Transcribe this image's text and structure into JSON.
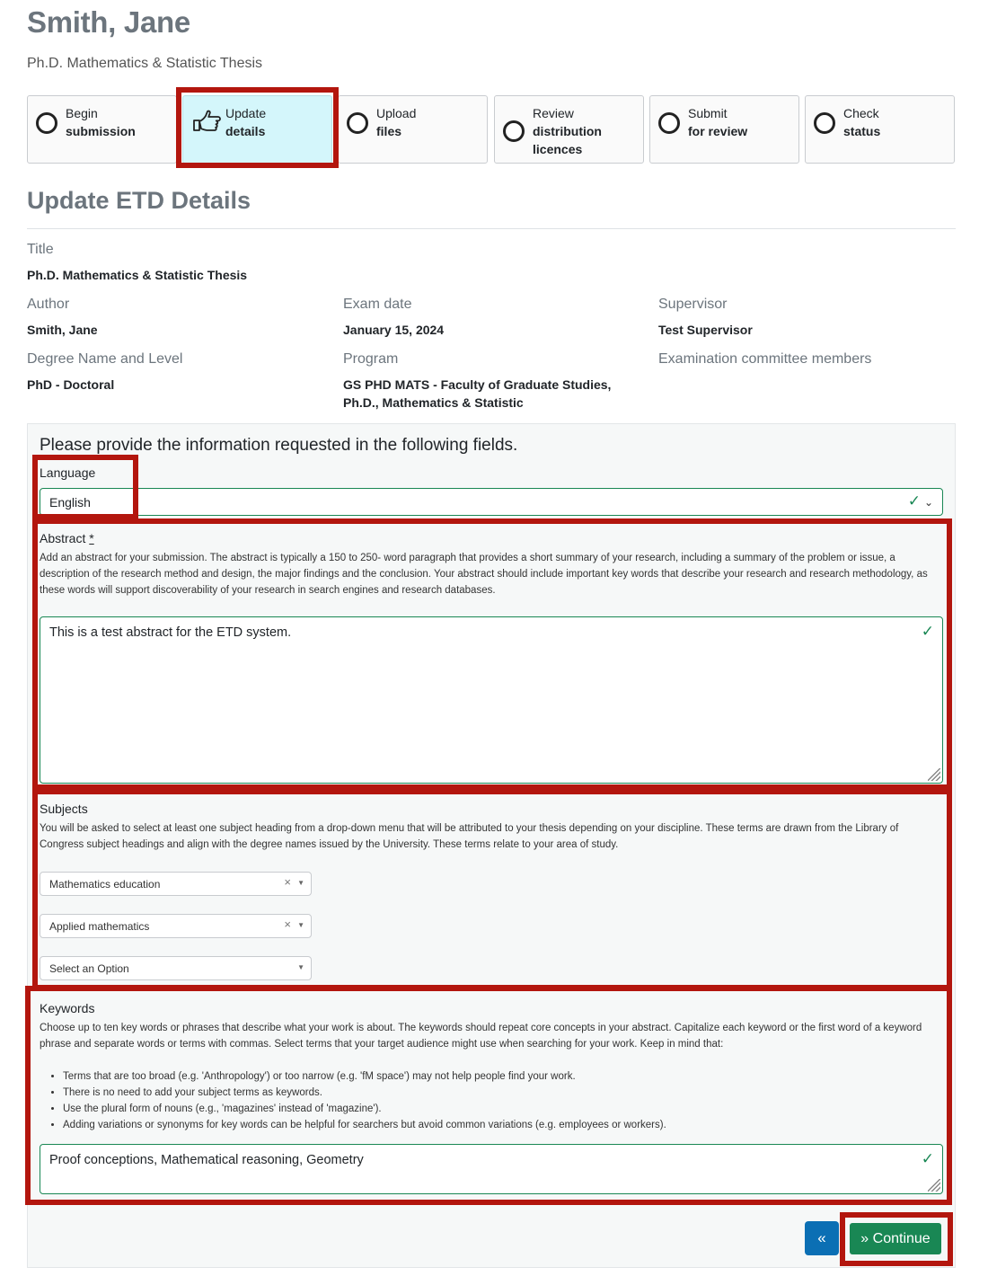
{
  "header": {
    "name": "Smith, Jane",
    "subtitle": "Ph.D. Mathematics & Statistic Thesis"
  },
  "steps": [
    {
      "line1": "Begin",
      "line2": "submission",
      "line3": ""
    },
    {
      "line1": "Update",
      "line2": "details",
      "line3": ""
    },
    {
      "line1": "Upload",
      "line2": "files",
      "line3": ""
    },
    {
      "line1": "Review",
      "line2": "distribution",
      "line3": "licences"
    },
    {
      "line1": "Submit",
      "line2": "for review",
      "line3": ""
    },
    {
      "line1": "Check",
      "line2": "status",
      "line3": ""
    }
  ],
  "section_title": "Update ETD Details",
  "details": {
    "title_label": "Title",
    "title_value": "Ph.D. Mathematics & Statistic Thesis",
    "author_label": "Author",
    "author_value": "Smith, Jane",
    "exam_label": "Exam date",
    "exam_value": "January 15, 2024",
    "supervisor_label": "Supervisor",
    "supervisor_value": "Test Supervisor",
    "degree_label": "Degree Name and Level",
    "degree_value": "PhD - Doctoral",
    "program_label": "Program",
    "program_line1": "GS PHD MATS - Faculty of Graduate Studies,",
    "program_line2": "Ph.D., Mathematics & Statistic",
    "committee_label": "Examination committee members"
  },
  "form": {
    "heading": "Please provide the information requested in the following fields.",
    "language_label": "Language",
    "language_value": "English",
    "abstract_label": "Abstract",
    "abstract_required": "*",
    "abstract_help": "Add an abstract for your submission. The abstract is typically a 150 to 250- word paragraph that provides a short summary of your research, including a summary of the problem or issue, a description of the research method and design, the major findings and the conclusion. Your abstract should include important key words that describe your research and research methodology, as these words will support discoverability of your research in search engines and research databases.",
    "abstract_value": "This is a test abstract for the ETD system.",
    "subjects_label": "Subjects",
    "subjects_help": "You will be asked to select at least one subject heading from a drop-down menu that will be attributed to your thesis depending on your discipline. These terms are drawn from the Library of Congress subject headings and align with the degree names issued by the University. These terms relate to your area of study.",
    "subject1": "Mathematics education",
    "subject2": "Applied mathematics",
    "subject_placeholder": "Select an Option",
    "keywords_label": "Keywords",
    "keywords_help": "Choose up to ten key words or phrases that describe what your work is about. The keywords should repeat core concepts in your abstract. Capitalize each keyword or the first word of a keyword phrase and separate words or terms with commas. Select terms that your target audience might use when searching for your work. Keep in mind that:",
    "keywords_bullets": [
      "Terms that are too broad (e.g. 'Anthropology') or too narrow (e.g. 'fM space') may not help people find your work.",
      "There is no need to add your subject terms as keywords.",
      "Use the plural form of nouns (e.g., 'magazines' instead of 'magazine').",
      "Adding variations or synonyms for key words can be helpful for searchers but avoid common variations (e.g. employees or workers)."
    ],
    "keywords_value": "Proof conceptions, Mathematical reasoning, Geometry"
  },
  "buttons": {
    "back_label": "«",
    "continue_label": "» Continue"
  },
  "icons": {
    "step_incomplete": "circle-outline-icon",
    "step_current": "pointing-hand-icon",
    "valid": "check-icon",
    "dropdown": "chevron-down-icon",
    "clear": "close-icon"
  },
  "colors": {
    "highlight": "#b3160e",
    "active_step": "#d4f6fb",
    "valid": "#198754",
    "continue": "#198754",
    "back": "#0b6fb4"
  }
}
